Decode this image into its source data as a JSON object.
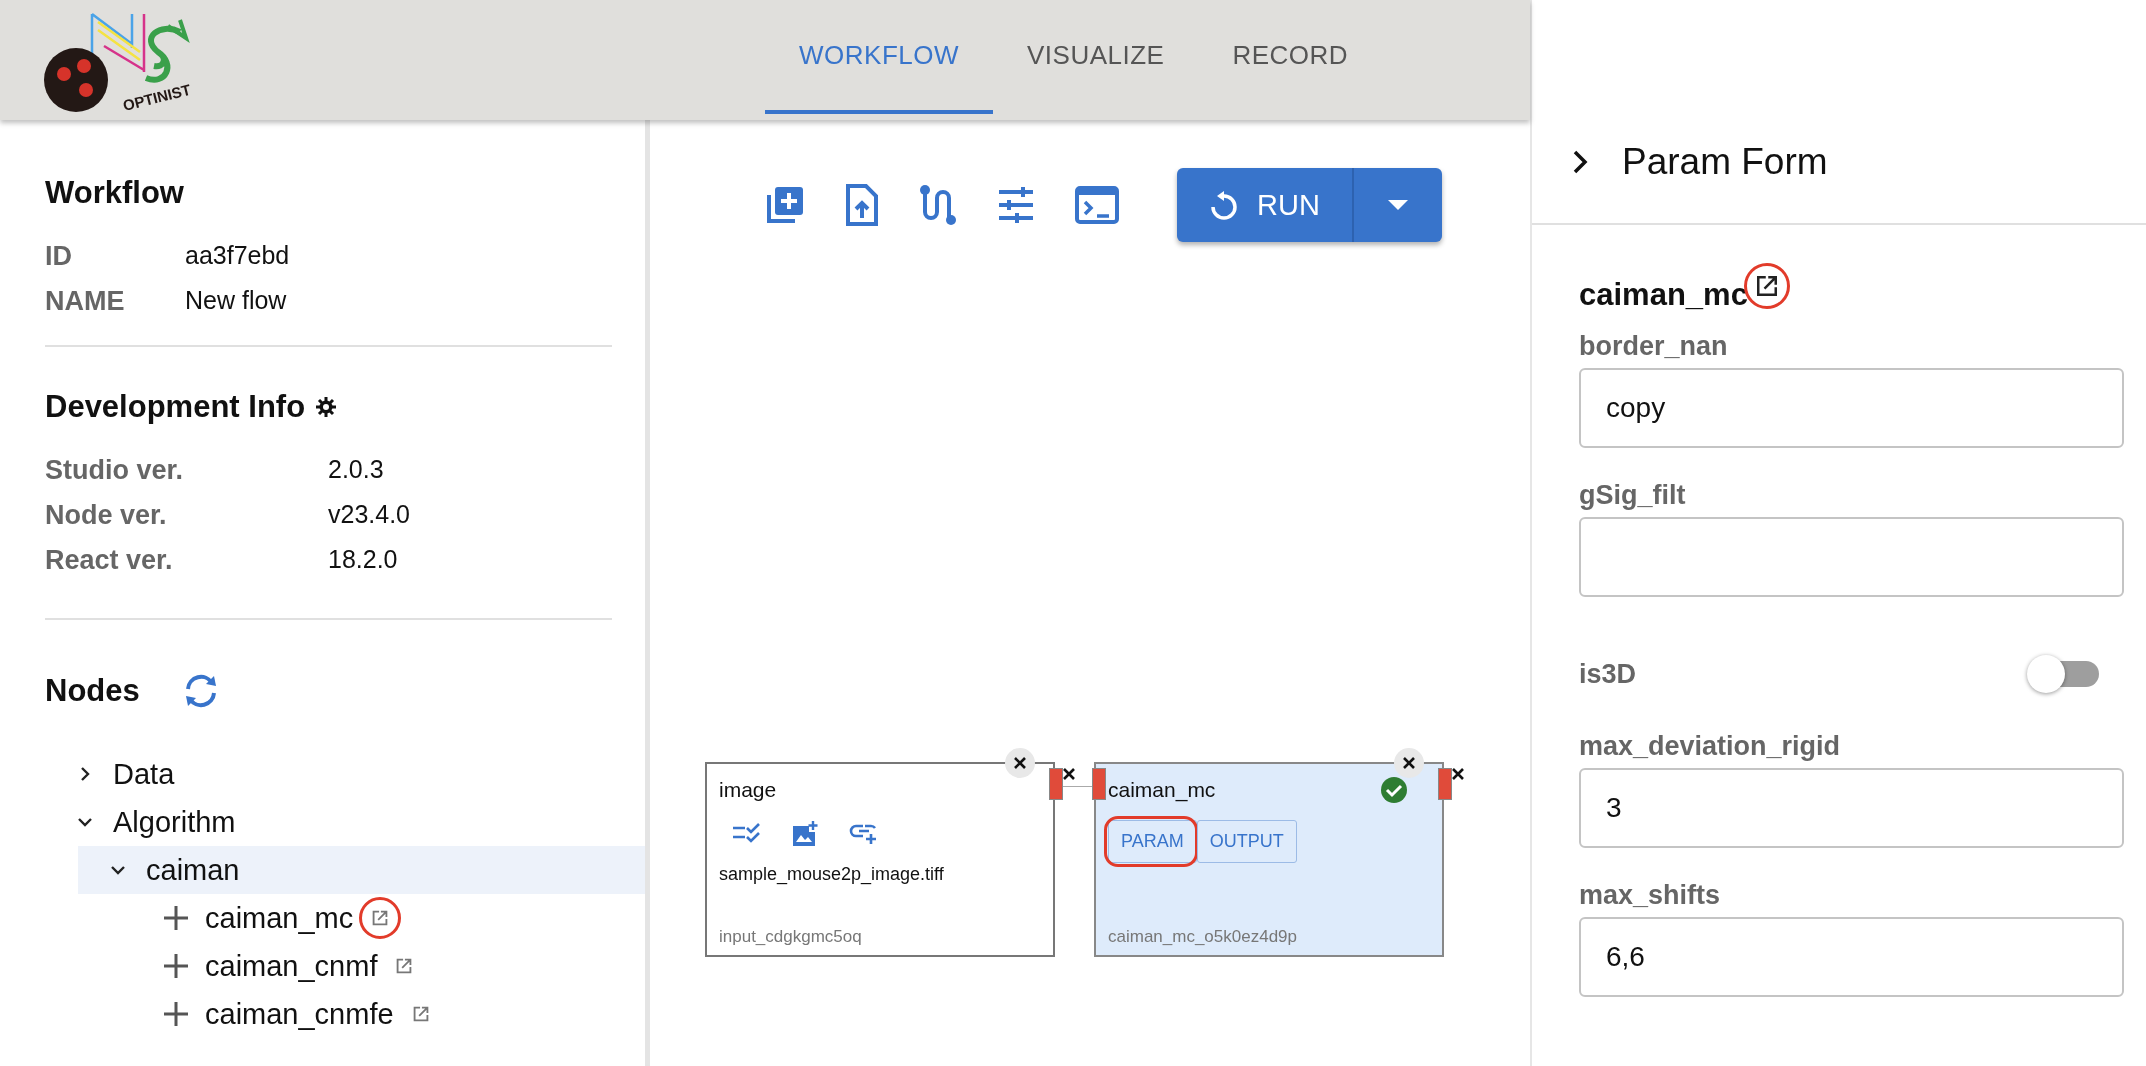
{
  "header": {
    "logo_text": "OPTINIST",
    "tabs": [
      {
        "label": "WORKFLOW",
        "selected": true
      },
      {
        "label": "VISUALIZE",
        "selected": false
      },
      {
        "label": "RECORD",
        "selected": false
      }
    ]
  },
  "workflow": {
    "title": "Workflow",
    "rows": [
      {
        "label": "ID",
        "value": "aa3f7ebd"
      },
      {
        "label": "NAME",
        "value": "New flow"
      }
    ]
  },
  "development_info": {
    "title": "Development Info",
    "rows": [
      {
        "label": "Studio ver.",
        "value": "2.0.3"
      },
      {
        "label": "Node ver.",
        "value": "v23.4.0"
      },
      {
        "label": "React ver.",
        "value": "18.2.0"
      }
    ]
  },
  "nodes_panel": {
    "title": "Nodes",
    "tree": [
      {
        "label": "Data",
        "kind": "folder",
        "expanded": false,
        "selected": false
      },
      {
        "label": "Algorithm",
        "kind": "folder",
        "expanded": true,
        "selected": false,
        "children": [
          {
            "label": "caiman",
            "kind": "folder",
            "expanded": true,
            "selected": true,
            "children": [
              {
                "label": "caiman_mc",
                "kind": "leaf",
                "selected": false,
                "highlighted": true
              },
              {
                "label": "caiman_cnmf",
                "kind": "leaf",
                "selected": false,
                "highlighted": false
              },
              {
                "label": "caiman_cnmfe",
                "kind": "leaf",
                "selected": false,
                "highlighted": false
              }
            ]
          }
        ]
      }
    ]
  },
  "toolbar": {
    "run_button": "RUN"
  },
  "canvas": {
    "nodes": [
      {
        "kind": "input",
        "title": "image",
        "file": "sample_mouse2p_image.tiff",
        "node_id": "input_cdgkgmc5oq",
        "selected": false
      },
      {
        "kind": "algorithm",
        "title": "caiman_mc",
        "node_id": "caiman_mc_o5k0ez4d9p",
        "selected": true,
        "done": true,
        "buttons": [
          {
            "label": "PARAM",
            "highlighted": true
          },
          {
            "label": "OUTPUT",
            "highlighted": false
          }
        ]
      }
    ]
  },
  "param_form": {
    "title": "Param Form",
    "node_name": "caiman_mc",
    "link_highlighted": true,
    "fields": [
      {
        "label": "border_nan",
        "kind": "text",
        "value": "copy"
      },
      {
        "label": "gSig_filt",
        "kind": "text"
      },
      {
        "label": "is3D",
        "kind": "switch",
        "on": false
      },
      {
        "label": "max_deviation_rigid",
        "kind": "text",
        "value": "3"
      },
      {
        "label": "max_shifts",
        "kind": "text",
        "value": "6,6"
      }
    ]
  }
}
